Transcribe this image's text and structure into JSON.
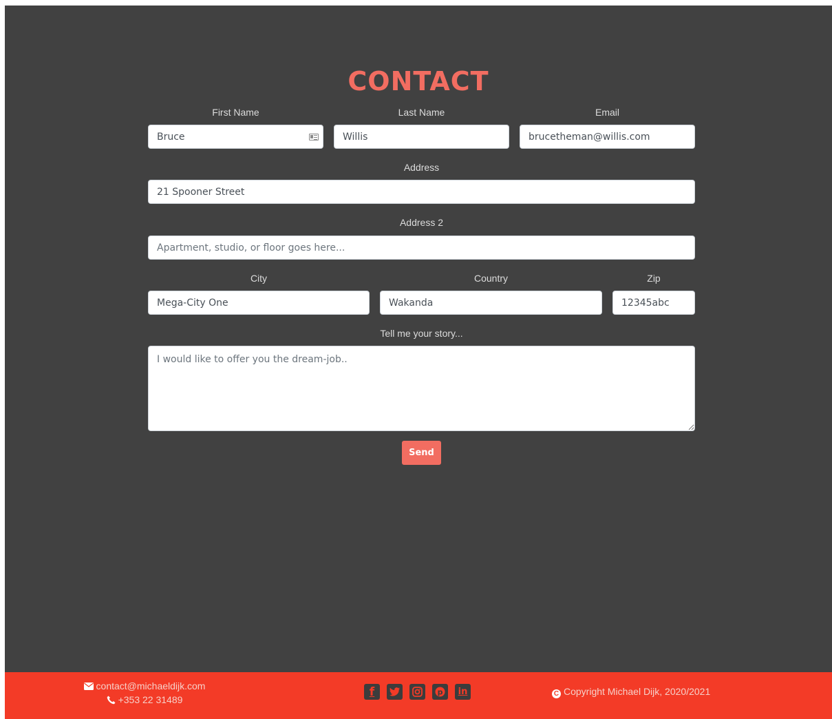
{
  "contact": {
    "title": "CONTACT",
    "labels": {
      "first_name": "First Name",
      "last_name": "Last Name",
      "email": "Email",
      "address": "Address",
      "address2": "Address 2",
      "city": "City",
      "country": "Country",
      "zip": "Zip",
      "story": "Tell me your story..."
    },
    "values": {
      "first_name": "Bruce",
      "last_name": "Willis",
      "email": "brucetheman@willis.com",
      "address": "21 Spooner Street",
      "city": "Mega-City One",
      "country": "Wakanda",
      "zip": "12345abc"
    },
    "placeholders": {
      "address2": "Apartment, studio, or floor goes here...",
      "story": "I would like to offer you the dream-job.."
    },
    "send_label": "Send"
  },
  "footer": {
    "email": "contact@michaeldijk.com",
    "phone": "+353 22 31489",
    "copyright": "Copyright Michael Dijk, 2020/2021",
    "social": [
      "facebook",
      "twitter",
      "instagram",
      "pinterest",
      "linkedin"
    ]
  },
  "colors": {
    "background": "#414141",
    "accent": "#f26d61",
    "footer": "#f33b27"
  }
}
